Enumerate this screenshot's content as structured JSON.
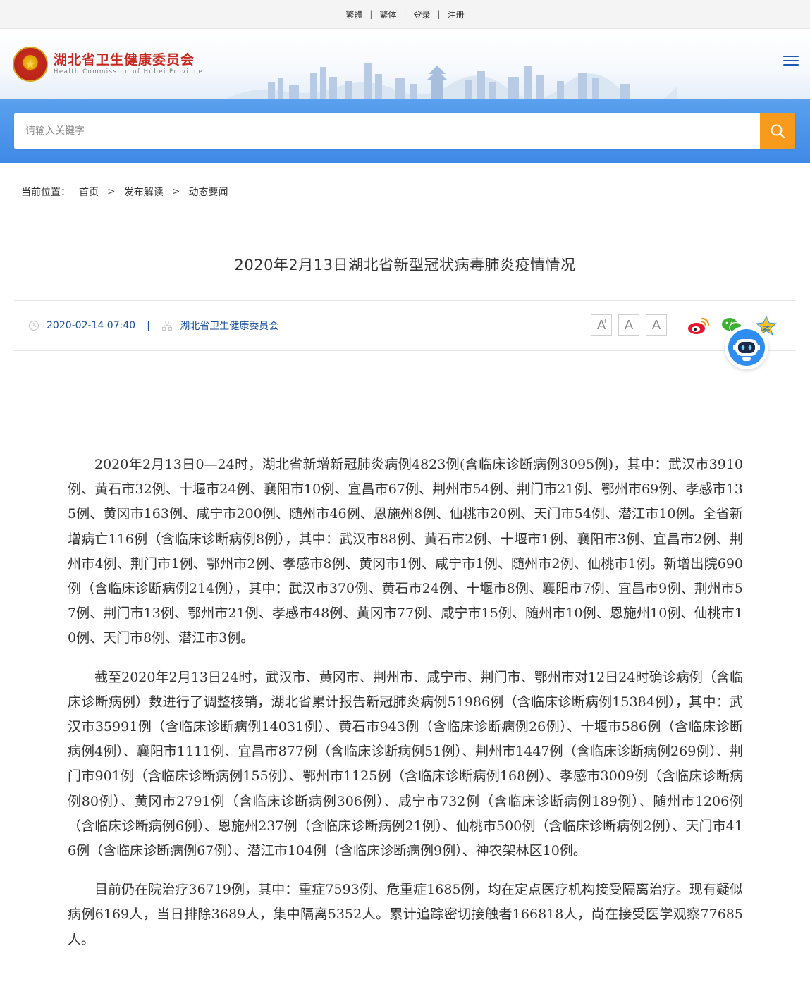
{
  "topbar": {
    "links": [
      "繁體",
      "繁体",
      "登录",
      "注册"
    ],
    "separator": "|"
  },
  "header": {
    "org_name_cn": "湖北省卫生健康委员会",
    "org_name_en": "Health Commission of Hubei Province"
  },
  "search": {
    "placeholder": "请输入关键字"
  },
  "breadcrumb": {
    "label": "当前位置：",
    "items": [
      "首页",
      "发布解读",
      "动态要闻"
    ],
    "separator": ">"
  },
  "article": {
    "title": "2020年2月13日湖北省新型冠状病毒肺炎疫情情况",
    "date": "2020-02-14 07:40",
    "meta_separator": "|",
    "source": "湖北省卫生健康委员会",
    "font_buttons": [
      "A",
      "A",
      "A"
    ],
    "font_button_marks": [
      "+",
      "-"
    ],
    "paragraphs": [
      "2020年2月13日0—24时，湖北省新增新冠肺炎病例4823例(含临床诊断病例3095例)，其中：武汉市3910例、黄石市32例、十堰市24例、襄阳市10例、宜昌市67例、荆州市54例、荆门市21例、鄂州市69例、孝感市135例、黄冈市163例、咸宁市200例、随州市46例、恩施州8例、仙桃市20例、天门市54例、潜江市10例。全省新增病亡116例（含临床诊断病例8例），其中：武汉市88例、黄石市2例、十堰市1例、襄阳市3例、宜昌市2例、荆州市4例、荆门市1例、鄂州市2例、孝感市8例、黄冈市1例、咸宁市1例、随州市2例、仙桃市1例。新增出院690例（含临床诊断病例214例），其中：武汉市370例、黄石市24例、十堰市8例、襄阳市7例、宜昌市9例、荆州市57例、荆门市13例、鄂州市21例、孝感市48例、黄冈市77例、咸宁市15例、随州市10例、恩施州10例、仙桃市10例、天门市8例、潜江市3例。",
      "截至2020年2月13日24时，武汉市、黄冈市、荆州市、咸宁市、荆门市、鄂州市对12日24时确诊病例（含临床诊断病例）数进行了调整核销，湖北省累计报告新冠肺炎病例51986例（含临床诊断病例15384例），其中：武汉市35991例（含临床诊断病例14031例）、黄石市943例（含临床诊断病例26例）、十堰市586例（含临床诊断病例4例）、襄阳市1111例、宜昌市877例（含临床诊断病例51例）、荆州市1447例（含临床诊断病例269例）、荆门市901例（含临床诊断病例155例）、鄂州市1125例（含临床诊断病例168例）、孝感市3009例（含临床诊断病例80例）、黄冈市2791例（含临床诊断病例306例）、咸宁市732例（含临床诊断病例189例）、随州市1206例（含临床诊断病例6例）、恩施州237例（含临床诊断病例21例）、仙桃市500例（含临床诊断病例2例）、天门市416例（含临床诊断病例67例）、潜江市104例（含临床诊断病例9例）、神农架林区10例。",
      "目前仍在院治疗36719例，其中：重症7593例、危重症1685例，均在定点医疗机构接受隔离治疗。现有疑似病例6169人，当日排除3689人，集中隔离5352人。累计追踪密切接触者166818人，尚在接受医学观察77685人。"
    ]
  },
  "icons": {
    "search": "search-icon",
    "menu": "hamburger-menu-icon",
    "clock": "clock-icon",
    "source": "org-chart-icon",
    "weibo": "weibo-icon",
    "wechat": "wechat-icon",
    "qzone": "qzone-icon",
    "robot": "robot-assistant-icon"
  },
  "colors": {
    "brand_red": "#c8281f",
    "search_band": "#4a93ea",
    "search_button": "#f89b1d",
    "meta_blue": "#1a4f9c",
    "menu_blue": "#1b5ab0"
  }
}
